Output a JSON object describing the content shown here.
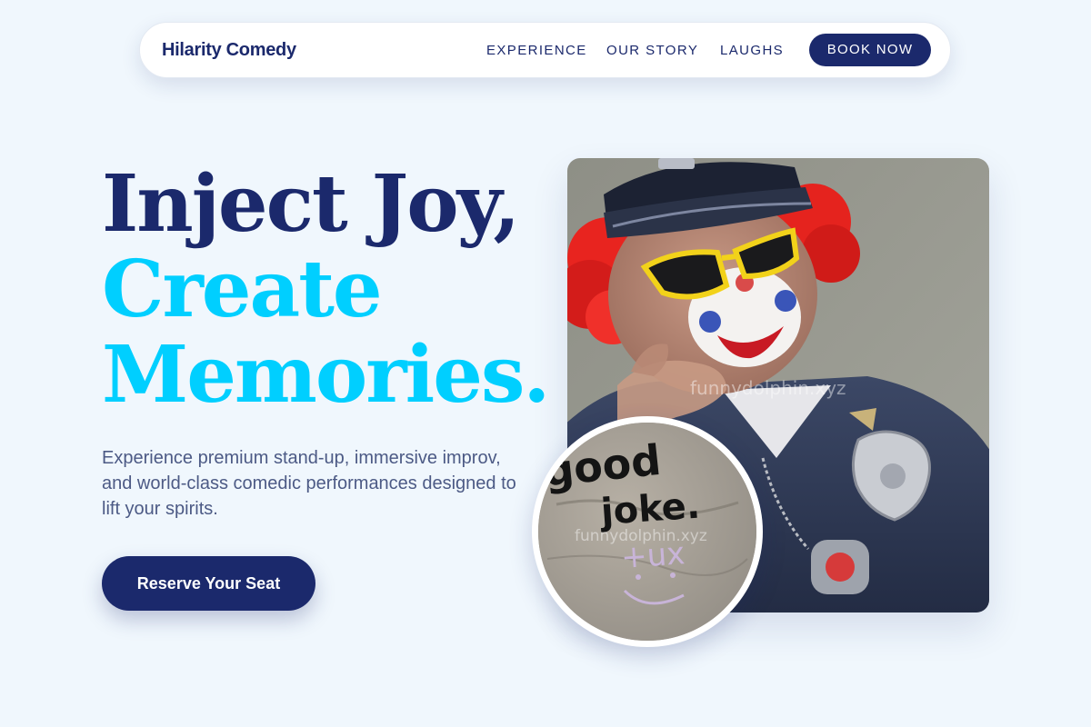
{
  "brand": "Hilarity Comedy",
  "nav": {
    "experience": "EXPERIENCE",
    "our_story": "OUR STORY",
    "laughs": "LAUGHS",
    "book_now": "BOOK NOW"
  },
  "hero": {
    "line1": "Inject Joy,",
    "line2": "Create",
    "line3": "Memories.",
    "subtext": "Experience premium stand-up, immersive improv, and world-class comedic performances designed to lift your spirits.",
    "cta": "Reserve Your Seat"
  },
  "images": {
    "main_watermark": "funnydolphin.xyz",
    "circle_watermark": "funnydolphin.xyz",
    "circle_graffiti_line1": "good",
    "circle_graffiti_line2": "joke.",
    "circle_graffiti_line3": "+ux"
  },
  "colors": {
    "primary": "#1b296c",
    "accent": "#00cfff",
    "background": "#f0f7fd"
  }
}
